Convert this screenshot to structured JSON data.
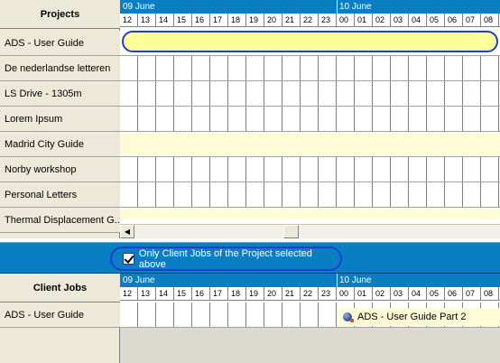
{
  "projects_panel": {
    "header": "Projects",
    "days": [
      "09 June",
      "10 June"
    ],
    "hours": [
      "12",
      "13",
      "14",
      "15",
      "16",
      "17",
      "18",
      "19",
      "20",
      "21",
      "22",
      "23",
      "00",
      "01",
      "02",
      "03",
      "04",
      "05",
      "06",
      "07",
      "08"
    ],
    "rows": [
      {
        "label": "ADS - User Guide"
      },
      {
        "label": "De nederlandse letteren"
      },
      {
        "label": "LS Drive - 1305m"
      },
      {
        "label": "Lorem Ipsum"
      },
      {
        "label": "Madrid City Guide"
      },
      {
        "label": "Norby workshop"
      },
      {
        "label": "Personal Letters"
      },
      {
        "label": "Thermal Displacement G..."
      }
    ]
  },
  "filter": {
    "checked": true,
    "label": "Only Client Jobs of the Project selected above"
  },
  "client_jobs_panel": {
    "header": "Client Jobs",
    "days": [
      "09 June",
      "10 June"
    ],
    "hours": [
      "12",
      "13",
      "14",
      "15",
      "16",
      "17",
      "18",
      "19",
      "20",
      "21",
      "22",
      "23",
      "00",
      "01",
      "02",
      "03",
      "04",
      "05",
      "06",
      "07",
      "08"
    ],
    "rows": [
      {
        "label": "ADS - User Guide",
        "job": "ADS - User Guide Part 2"
      }
    ]
  },
  "colors": {
    "header_blue": "#0a7ec2",
    "highlight_outline": "#1b3fd1",
    "task_yellow": "#ffff99",
    "cream": "#fffbd6"
  }
}
